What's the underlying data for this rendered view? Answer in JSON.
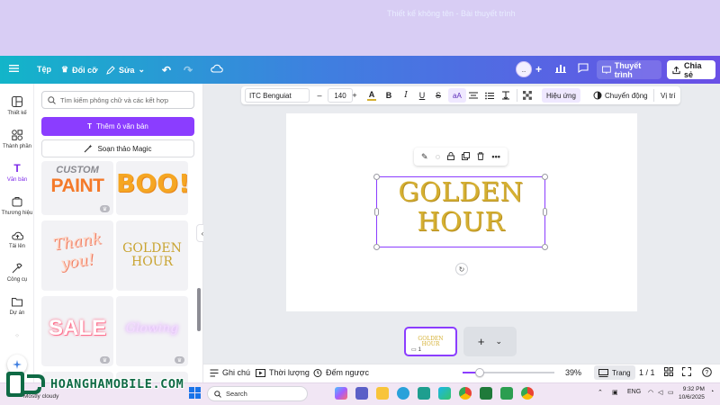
{
  "header": {
    "menu_file": "Tệp",
    "menu_resize": "Đổi cỡ",
    "menu_edit": "Sửa",
    "doc_title": "Thiết kế không tên - Bài thuyết trình",
    "avatar_initials": "..",
    "present_label": "Thuyết trình",
    "share_label": "Chia sẻ",
    "accent_color": "#8b3dff"
  },
  "rail": {
    "items": [
      {
        "label": "Thiết kế",
        "icon": "layout-icon"
      },
      {
        "label": "Thành phần",
        "icon": "elements-icon"
      },
      {
        "label": "Văn bản",
        "icon": "text-icon"
      },
      {
        "label": "Thương hiệu",
        "icon": "brand-icon"
      },
      {
        "label": "Tải lên",
        "icon": "upload-icon"
      },
      {
        "label": "Công cụ",
        "icon": "tools-icon"
      },
      {
        "label": "Dự án",
        "icon": "folder-icon"
      }
    ]
  },
  "panel": {
    "search_placeholder": "Tìm kiếm phông chữ và các kết hợp",
    "add_text_label": "Thêm ô văn bản",
    "magic_label": "Soạn thảo Magic",
    "tiles": [
      {
        "line1": "CUSTOM",
        "line2": "PAINT"
      },
      {
        "line1": "BOO!"
      },
      {
        "line1": "Thank",
        "line2": "you!"
      },
      {
        "line1": "GOLDEN",
        "line2": "HOUR"
      },
      {
        "line1": "SALE"
      },
      {
        "line1": "Glowing"
      }
    ]
  },
  "toolbar": {
    "font_name": "ITC Benguiat",
    "minus": "–",
    "font_size": "140",
    "plus": "+",
    "case_label": "aA",
    "effects_label": "Hiệu ứng",
    "animate_label": "Chuyển động",
    "position_label": "Vị trí"
  },
  "canvas": {
    "line1": "GOLDEN",
    "line2": "HOUR",
    "text_color": "#d5b032"
  },
  "thumbnail": {
    "line1": "GOLDEN",
    "line2": "HOUR",
    "page_number": "1"
  },
  "footer": {
    "notes_label": "Ghi chú",
    "duration_label": "Thời lượng",
    "timer_label": "Đếm ngược",
    "zoom_value": 39,
    "zoom_label": "39%",
    "pages_label": "Trang",
    "page_counter": "1 / 1"
  },
  "taskbar": {
    "search_label": "Search",
    "weather_text": "Mostly cloudy",
    "lang": "ENG",
    "time": "9:32 PM",
    "date": "10/6/2025"
  },
  "watermark": {
    "text": "HOANGHAMOBILE.COM"
  }
}
